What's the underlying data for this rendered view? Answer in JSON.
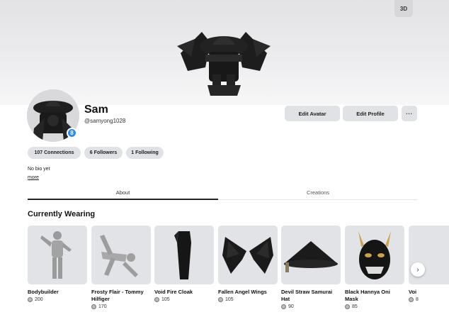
{
  "banner": {
    "btn_3d": "3D"
  },
  "profile": {
    "display_name": "Sam",
    "username": "@samyong1028",
    "verified_icon": "verified-badge-icon"
  },
  "actions": {
    "edit_avatar": "Edit Avatar",
    "edit_profile": "Edit Profile",
    "more": "···"
  },
  "stats": {
    "connections": "107 Connections",
    "followers": "6 Followers",
    "following": "1 Following"
  },
  "bio": {
    "text": "No bio yet",
    "more": "more"
  },
  "tabs": [
    {
      "label": "About"
    },
    {
      "label": "Creations"
    }
  ],
  "wearing": {
    "title": "Currently Wearing",
    "items": [
      {
        "name": "Bodybuilder",
        "price": "200"
      },
      {
        "name": "Frosty Flair - Tommy Hilfiger",
        "price": "170"
      },
      {
        "name": "Void Fire Cloak",
        "price": "105"
      },
      {
        "name": "Fallen Angel Wings",
        "price": "105"
      },
      {
        "name": "Devil Straw Samurai Hat",
        "price": "90"
      },
      {
        "name": "Black Hannya Oni Mask",
        "price": "85"
      },
      {
        "name": "Voi",
        "price": "8"
      }
    ]
  },
  "colors": {
    "accent_blue": "#2a8cf0",
    "button_bg": "#e1e2e6"
  }
}
